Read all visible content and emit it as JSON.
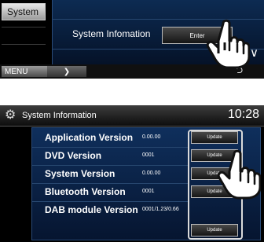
{
  "top_screen": {
    "side_tab": "System",
    "system_information_label": "System Infomation",
    "enter_button": "Enter",
    "menu_label": "MENU",
    "menu_arrow": "❯",
    "scroll_down_icon": "chevron-down",
    "back_icon": "return-arrow"
  },
  "bottom_screen": {
    "title": "System Information",
    "clock": "10:28",
    "rows": [
      {
        "name": "Application Version",
        "version": "0.00.00",
        "button": "Update"
      },
      {
        "name": "DVD Version",
        "version": "0001",
        "button": "Update"
      },
      {
        "name": "System Version",
        "version": "0.00.00",
        "button": "Update"
      },
      {
        "name": "Bluetooth Version",
        "version": "0001",
        "button": "Update"
      },
      {
        "name": "DAB module Version",
        "version": "0001/1.23/0.66",
        "button": ""
      },
      {
        "name": "",
        "version": "",
        "button": "Update"
      }
    ]
  },
  "colors": {
    "panel_blue": "#0d2b52",
    "button_border": "#bbbbbb",
    "text": "#ffffff"
  }
}
